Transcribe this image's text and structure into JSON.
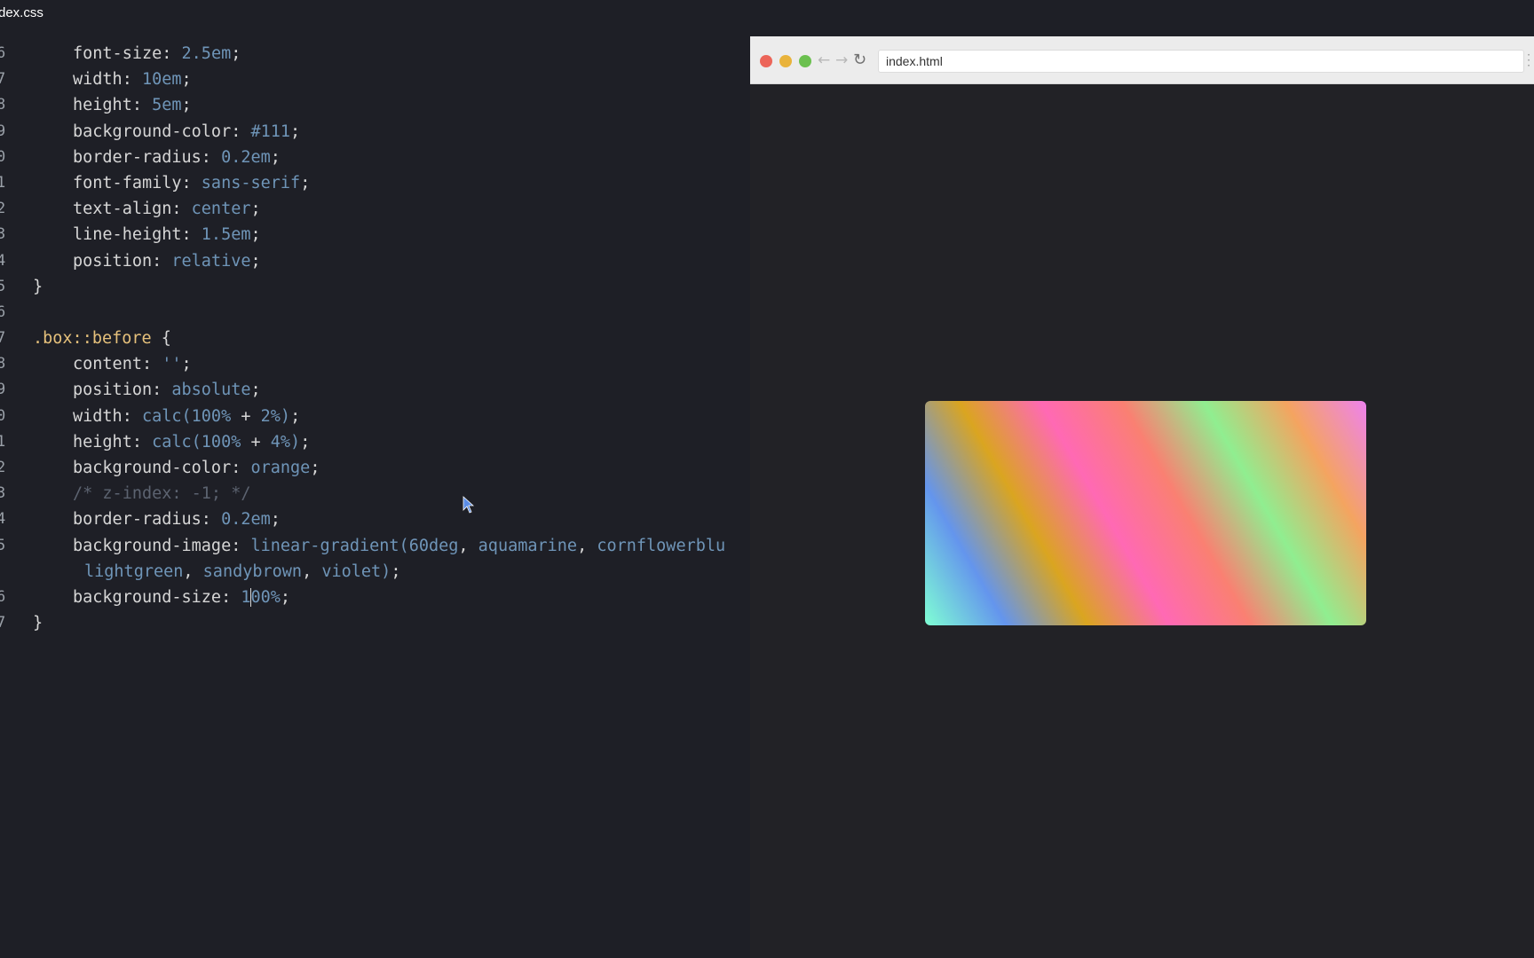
{
  "editor": {
    "tab_title": "dex.css",
    "lines": [
      {
        "num": "6",
        "tokens": [
          [
            "indent",
            ""
          ],
          [
            "prop",
            "font-size: "
          ],
          [
            "val",
            "2.5em"
          ],
          [
            "punc",
            ";"
          ]
        ]
      },
      {
        "num": "7",
        "tokens": [
          [
            "indent",
            ""
          ],
          [
            "prop",
            "width: "
          ],
          [
            "val",
            "10em"
          ],
          [
            "punc",
            ";"
          ]
        ]
      },
      {
        "num": "8",
        "tokens": [
          [
            "indent",
            ""
          ],
          [
            "prop",
            "height: "
          ],
          [
            "val",
            "5em"
          ],
          [
            "punc",
            ";"
          ]
        ]
      },
      {
        "num": "9",
        "tokens": [
          [
            "indent",
            ""
          ],
          [
            "prop",
            "background-color: "
          ],
          [
            "val",
            "#111"
          ],
          [
            "punc",
            ";"
          ]
        ]
      },
      {
        "num": "0",
        "tokens": [
          [
            "indent",
            ""
          ],
          [
            "prop",
            "border-radius: "
          ],
          [
            "val",
            "0.2em"
          ],
          [
            "punc",
            ";"
          ]
        ]
      },
      {
        "num": "1",
        "tokens": [
          [
            "indent",
            ""
          ],
          [
            "prop",
            "font-family: "
          ],
          [
            "val",
            "sans-serif"
          ],
          [
            "punc",
            ";"
          ]
        ]
      },
      {
        "num": "2",
        "tokens": [
          [
            "indent",
            ""
          ],
          [
            "prop",
            "text-align: "
          ],
          [
            "val",
            "center"
          ],
          [
            "punc",
            ";"
          ]
        ]
      },
      {
        "num": "3",
        "tokens": [
          [
            "indent",
            ""
          ],
          [
            "prop",
            "line-height: "
          ],
          [
            "val",
            "1.5em"
          ],
          [
            "punc",
            ";"
          ]
        ]
      },
      {
        "num": "4",
        "tokens": [
          [
            "indent",
            ""
          ],
          [
            "prop",
            "position: "
          ],
          [
            "val",
            "relative"
          ],
          [
            "punc",
            ";"
          ]
        ]
      },
      {
        "num": "5",
        "tokens": [
          [
            "punc",
            "}"
          ]
        ]
      },
      {
        "num": "6",
        "tokens": []
      },
      {
        "num": "7",
        "tokens": [
          [
            "sel",
            ".box::before "
          ],
          [
            "punc",
            "{"
          ]
        ]
      },
      {
        "num": "8",
        "tokens": [
          [
            "indent",
            ""
          ],
          [
            "prop",
            "content: "
          ],
          [
            "val",
            "''"
          ],
          [
            "punc",
            ";"
          ]
        ]
      },
      {
        "num": "9",
        "tokens": [
          [
            "indent",
            ""
          ],
          [
            "prop",
            "position: "
          ],
          [
            "val",
            "absolute"
          ],
          [
            "punc",
            ";"
          ]
        ]
      },
      {
        "num": "0",
        "tokens": [
          [
            "indent",
            ""
          ],
          [
            "prop",
            "width: "
          ],
          [
            "val",
            "calc(100% "
          ],
          [
            "punc",
            "+ "
          ],
          [
            "val",
            "2%)"
          ],
          [
            "punc",
            ";"
          ]
        ]
      },
      {
        "num": "1",
        "tokens": [
          [
            "indent",
            ""
          ],
          [
            "prop",
            "height: "
          ],
          [
            "val",
            "calc(100% "
          ],
          [
            "punc",
            "+ "
          ],
          [
            "val",
            "4%)"
          ],
          [
            "punc",
            ";"
          ]
        ]
      },
      {
        "num": "2",
        "tokens": [
          [
            "indent",
            ""
          ],
          [
            "prop",
            "background-color: "
          ],
          [
            "val",
            "orange"
          ],
          [
            "punc",
            ";"
          ]
        ]
      },
      {
        "num": "3",
        "tokens": [
          [
            "indent",
            ""
          ],
          [
            "comment",
            "/* z-index: -1; */"
          ]
        ]
      },
      {
        "num": "4",
        "tokens": [
          [
            "indent",
            ""
          ],
          [
            "prop",
            "border-radius: "
          ],
          [
            "val",
            "0.2em"
          ],
          [
            "punc",
            ";"
          ]
        ]
      },
      {
        "num": "5",
        "tokens": [
          [
            "indent",
            ""
          ],
          [
            "prop",
            "background-image: "
          ],
          [
            "val",
            "linear-gradient(60deg"
          ],
          [
            "punc",
            ", "
          ],
          [
            "val",
            "aquamarine"
          ],
          [
            "punc",
            ", "
          ],
          [
            "val",
            "cornflowerblu"
          ]
        ]
      },
      {
        "num": "",
        "tokens": [
          [
            "wrap",
            ""
          ],
          [
            "val",
            "lightgreen"
          ],
          [
            "punc",
            ", "
          ],
          [
            "val",
            "sandybrown"
          ],
          [
            "punc",
            ", "
          ],
          [
            "val",
            "violet)"
          ],
          [
            "punc",
            ";"
          ]
        ]
      },
      {
        "num": "6",
        "tokens": [
          [
            "indent",
            ""
          ],
          [
            "prop",
            "background-size: "
          ],
          [
            "val",
            "1"
          ],
          [
            "caret",
            ""
          ],
          [
            "val",
            "00%"
          ],
          [
            "punc",
            ";"
          ]
        ]
      },
      {
        "num": "7",
        "tokens": [
          [
            "punc",
            "}"
          ]
        ]
      }
    ]
  },
  "browser": {
    "address": "index.html",
    "nav": {
      "back": "←",
      "forward": "→",
      "reload": "↻"
    },
    "preview_gradient": [
      "aquamarine",
      "cornflowerblue",
      "goldenrod",
      "hotpink",
      "salmon",
      "lightgreen",
      "sandybrown",
      "violet"
    ]
  },
  "colors": {
    "editor_bg": "#1e1f26",
    "property": "#d6d6d6",
    "value": "#6f95b8",
    "selector": "#e5c07b",
    "comment": "#5c6370"
  }
}
